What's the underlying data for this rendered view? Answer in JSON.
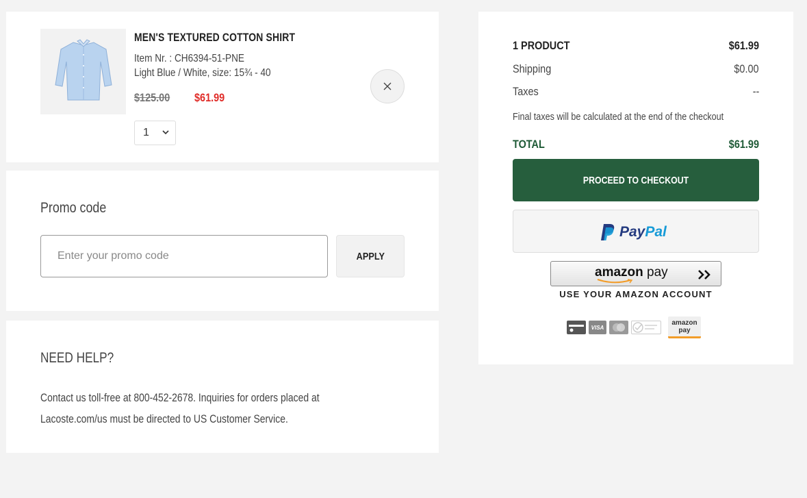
{
  "cart": {
    "product": {
      "name": "MEN'S TEXTURED COTTON SHIRT",
      "item_number": "Item Nr. : CH6394-51-PNE",
      "variant": "Light Blue / White, size: 15¾ - 40",
      "original_price": "$125.00",
      "sale_price": "$61.99",
      "quantity": "1",
      "image_icon": "shirt-icon",
      "remove_icon": "close-icon"
    }
  },
  "promo": {
    "label": "Promo code",
    "placeholder": "Enter your promo code",
    "apply_label": "APPLY"
  },
  "help": {
    "title": "NEED HELP?",
    "text": "Contact us toll-free at 800-452-2678. Inquiries for orders placed at Lacoste.com/us must be directed to US Customer Service."
  },
  "summary": {
    "products_label": "1 PRODUCT",
    "products_value": "$61.99",
    "shipping_label": "Shipping",
    "shipping_value": "$0.00",
    "taxes_label": "Taxes",
    "taxes_value": "--",
    "note": "Final taxes will be calculated at the end of the checkout",
    "total_label": "TOTAL",
    "total_value": "$61.99",
    "checkout_label": "PROCEED TO CHECKOUT",
    "paypal_a": "Pay",
    "paypal_b": "Pal",
    "amazon_a": "amazon",
    "amazon_b": " pay",
    "amazon_sub": "USE YOUR AMAZON ACCOUNT",
    "payment_icons": [
      "card-icon",
      "visa-icon",
      "mastercard-icon",
      "verified-icon",
      "amazon-pay-icon"
    ],
    "visa_text": "VISA",
    "amz_icon_a": "amazon",
    "amz_icon_b": "pay"
  },
  "colors": {
    "accent_green": "#265e3d",
    "total_green": "#1e5a36",
    "sale_red": "#e02b27",
    "background": "#f3f3f3"
  }
}
